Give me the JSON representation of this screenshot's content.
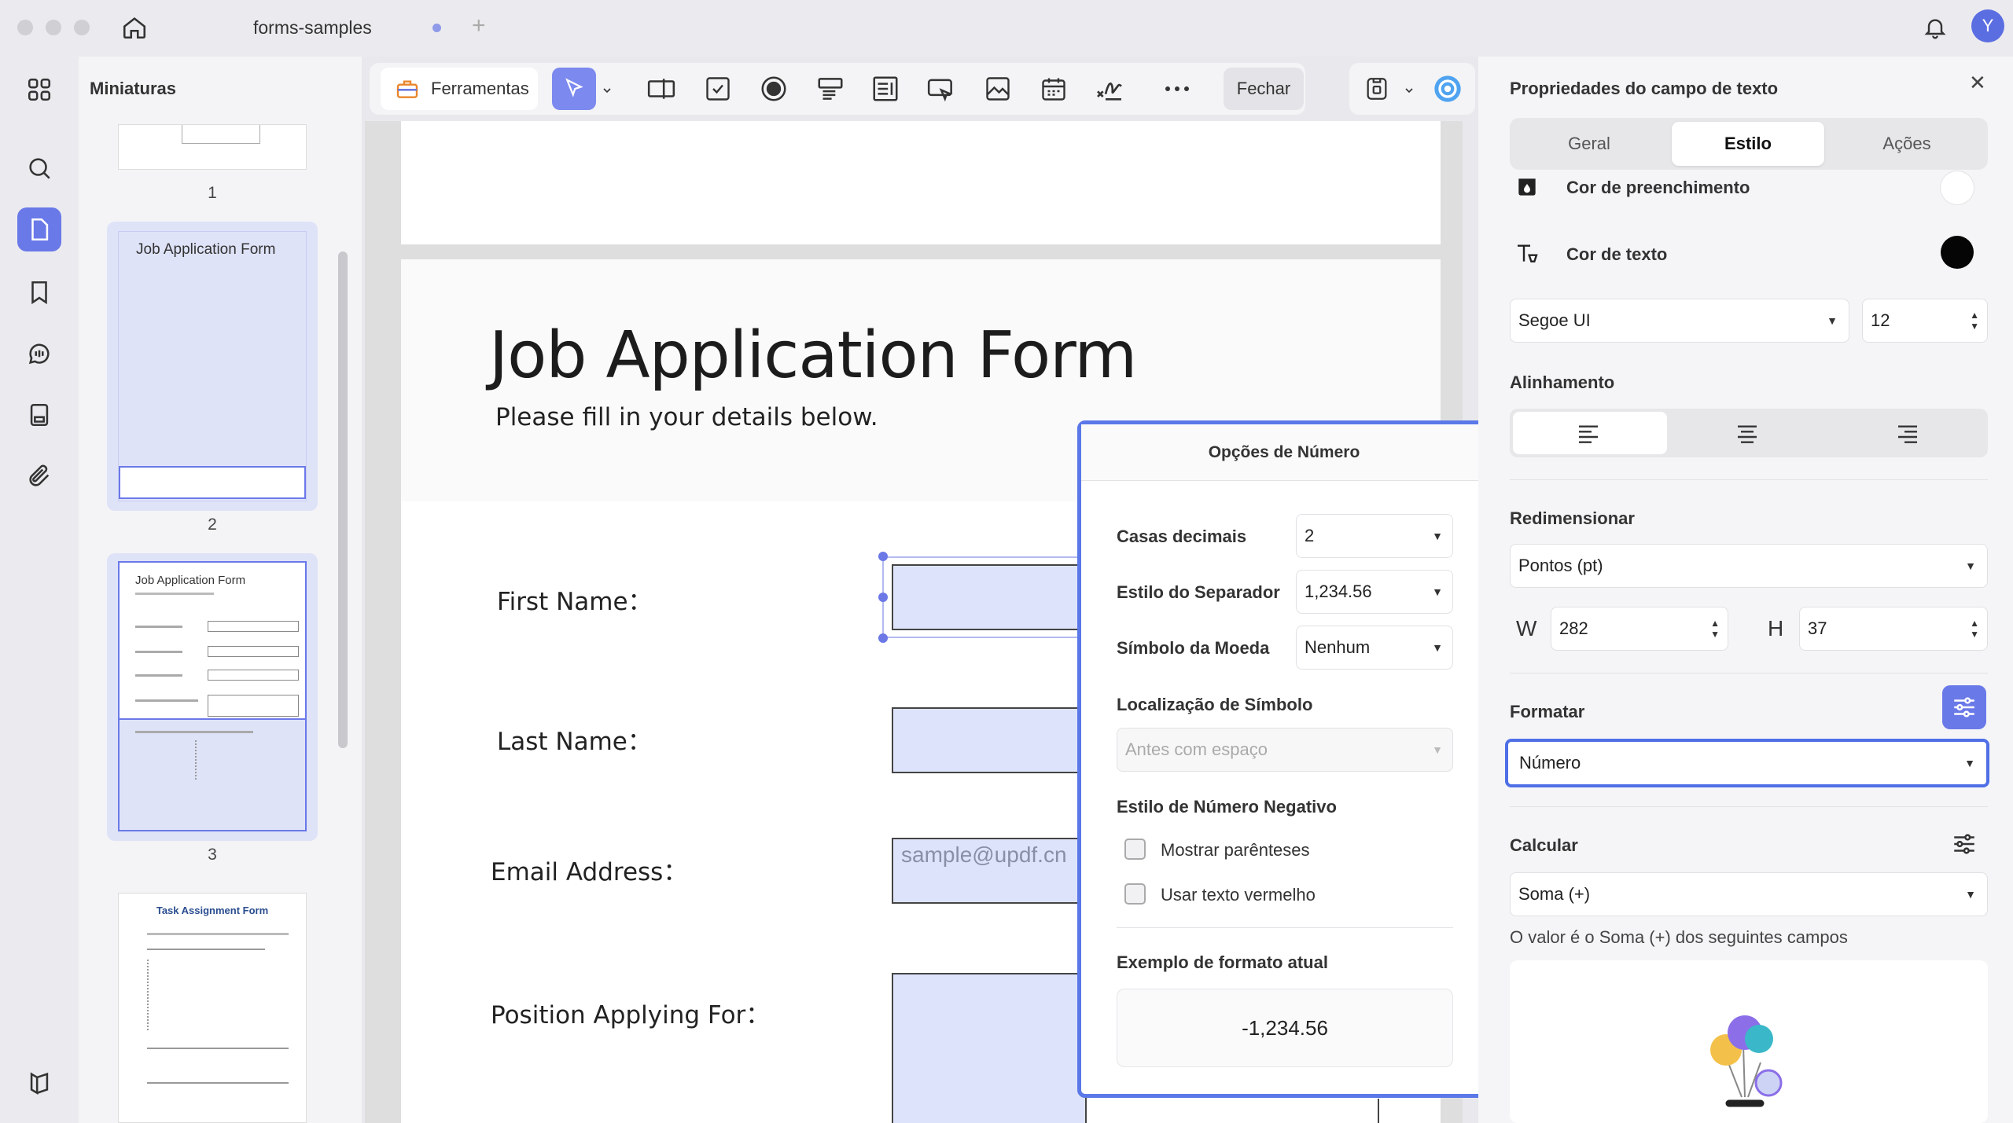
{
  "app": {
    "tab_title": "forms-samples",
    "avatar_initial": "Y",
    "thumbnails_title": "Miniaturas"
  },
  "thumbnails": [
    {
      "page": "1"
    },
    {
      "page": "2",
      "title": "Job Application Form"
    },
    {
      "page": "3",
      "title": "Job Application Form"
    },
    {
      "title": "Task Assignment Form"
    }
  ],
  "toolbar": {
    "tools_label": "Ferramentas",
    "close_label": "Fechar"
  },
  "document": {
    "title": "Job Application Form",
    "subtitle": "Please fill in your details below.",
    "fields": [
      {
        "label": "First Name："
      },
      {
        "label": "Last Name："
      },
      {
        "label": "Email Address：",
        "placeholder": "sample@updf.cn"
      },
      {
        "label": "Position Applying For："
      }
    ]
  },
  "number_options": {
    "title": "Opções de Número",
    "decimal_label": "Casas decimais",
    "decimal_value": "2",
    "separator_label": "Estilo do Separador",
    "separator_value": "1,234.56",
    "currency_label": "Símbolo da Moeda",
    "currency_value": "Nenhum",
    "symbol_location_label": "Localização de Símbolo",
    "symbol_location_value": "Antes com espaço",
    "negative_label": "Estilo de Número Negativo",
    "show_parentheses": "Mostrar parênteses",
    "use_red_text": "Usar texto vermelho",
    "example_label": "Exemplo de formato atual",
    "example_value": "-1,234.56"
  },
  "properties": {
    "title": "Propriedades do campo de texto",
    "tabs": [
      "Geral",
      "Estilo",
      "Ações"
    ],
    "fill_color_label": "Cor de preenchimento",
    "text_color_label": "Cor de texto",
    "font": "Segoe UI",
    "font_size": "12",
    "alignment_label": "Alinhamento",
    "resize_label": "Redimensionar",
    "unit": "Pontos (pt)",
    "w_label": "W",
    "w_value": "282",
    "h_label": "H",
    "h_value": "37",
    "format_label": "Formatar",
    "format_value": "Número",
    "calculate_label": "Calcular",
    "calculate_value": "Soma (+)",
    "calculate_desc": "O valor é o Soma (+) dos seguintes campos"
  },
  "colors": {
    "accent": "#6a79e8",
    "field_fill": "#dde3fb",
    "popup_border": "#5b78e8"
  }
}
